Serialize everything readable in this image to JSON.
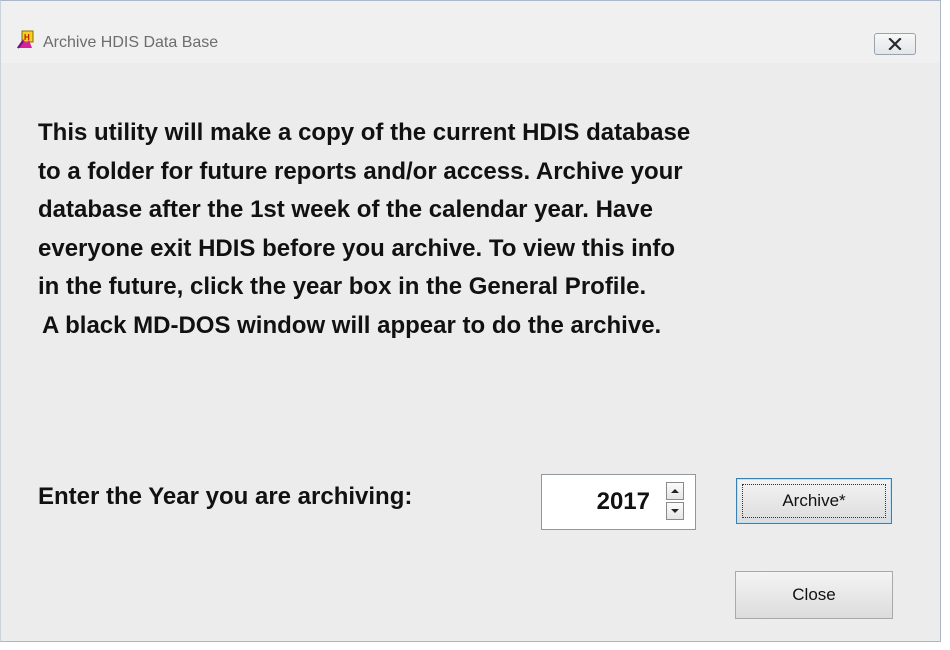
{
  "window": {
    "title": "Archive HDIS Data Base",
    "icon": "hdis-app-icon",
    "close_icon": "close-x-icon"
  },
  "info": {
    "lines": [
      "This utility will make a copy of the current HDIS database",
      "to a folder for future reports and/or access.  Archive your",
      "database after the 1st week of the calendar year.  Have",
      "everyone exit HDIS before you archive.  To view this info",
      "in the future, click the year box in the General Profile.",
      "A black MD-DOS window will appear to do the archive."
    ]
  },
  "year_field": {
    "label": "Enter the Year you are archiving:",
    "value": "2017"
  },
  "buttons": {
    "archive_label": "Archive*",
    "close_label": "Close"
  },
  "colors": {
    "dialog_background": "#ececec",
    "focused_button_border": "#3c7fb1"
  }
}
